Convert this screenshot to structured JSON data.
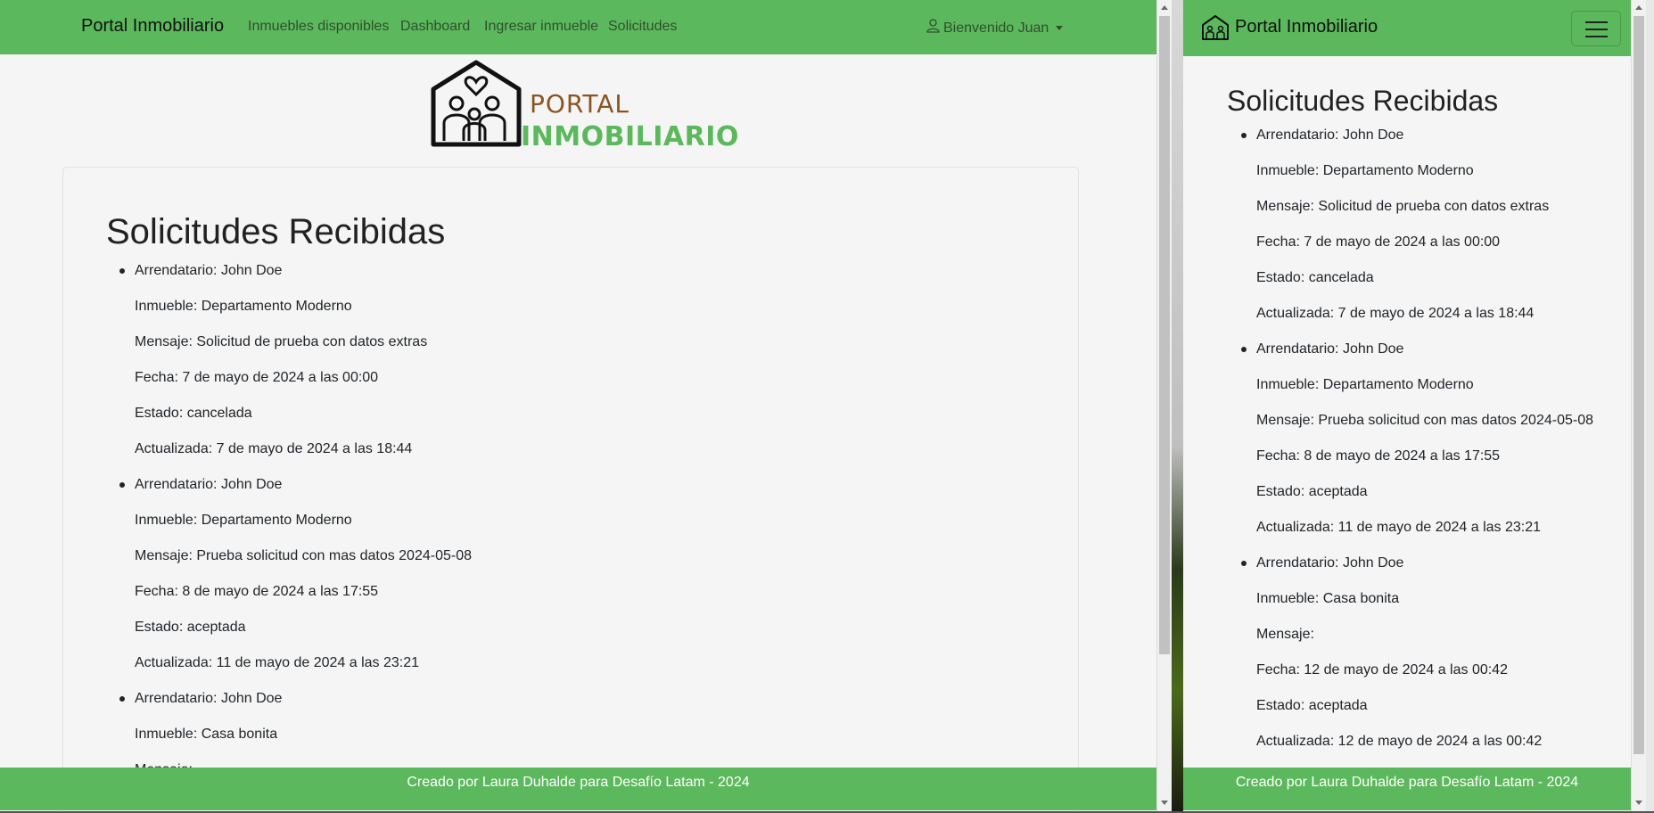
{
  "left": {
    "nav": {
      "brand": "Portal Inmobiliario",
      "links": [
        "Inmuebles disponibles",
        "Dashboard",
        "Ingresar inmueble",
        "Solicitudes"
      ],
      "user_menu": "Bienvenido Juan"
    },
    "logo": {
      "top_text": "PORTAL",
      "bottom_text": "INMOBILIARIO"
    },
    "title": "Solicitudes Recibidas",
    "footer": "Creado por Laura Duhalde para Desafío Latam - 2024"
  },
  "right": {
    "nav": {
      "brand": "Portal Inmobiliario"
    },
    "title": "Solicitudes Recibidas",
    "footer": "Creado por Laura Duhalde para Desafío Latam - 2024"
  },
  "requests": [
    {
      "arrendatario": "Arrendatario: John Doe",
      "inmueble": "Inmueble: Departamento Moderno",
      "mensaje": "Mensaje: Solicitud de prueba con datos extras",
      "fecha": "Fecha: 7 de mayo de 2024 a las 00:00",
      "estado": "Estado: cancelada",
      "actualizada": "Actualizada: 7 de mayo de 2024 a las 18:44"
    },
    {
      "arrendatario": "Arrendatario: John Doe",
      "inmueble": "Inmueble: Departamento Moderno",
      "mensaje": "Mensaje: Prueba solicitud con mas datos 2024-05-08",
      "fecha": "Fecha: 8 de mayo de 2024 a las 17:55",
      "estado": "Estado: aceptada",
      "actualizada": "Actualizada: 11 de mayo de 2024 a las 23:21"
    },
    {
      "arrendatario": "Arrendatario: John Doe",
      "inmueble": "Inmueble: Casa bonita",
      "mensaje": "Mensaje:",
      "fecha": "Fecha: 12 de mayo de 2024 a las 00:42",
      "estado": "Estado: aceptada",
      "actualizada": "Actualizada: 12 de mayo de 2024 a las 00:42"
    }
  ],
  "colors": {
    "brand_green": "#5cb85c",
    "logo_brown": "#8a5524",
    "page_bg": "#f5f5f5"
  },
  "icons": {
    "user": "user-icon",
    "caret": "caret-down-icon",
    "house_logo": "house-family-logo",
    "navbar_toggler": "hamburger-icon"
  }
}
